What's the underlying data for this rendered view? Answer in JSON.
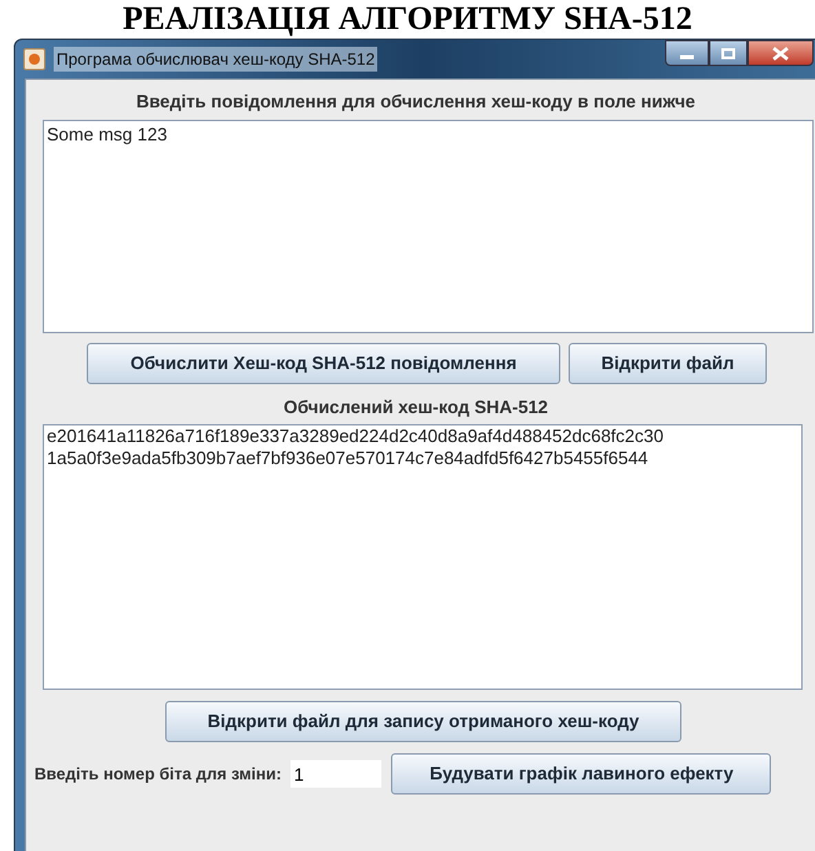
{
  "heading": "РЕАЛІЗАЦІЯ АЛГОРИТМУ SHA-512",
  "window": {
    "title": "Програма обчислювач хеш-коду SHA-512"
  },
  "message_label": "Введіть повідомлення для обчислення хеш-коду в поле нижче",
  "message_field": {
    "value": "Some msg 123"
  },
  "buttons": [
    {
      "label": "Обчислити Хеш-код SHA-512 повідомлення"
    },
    {
      "label": "Відкрити файл"
    }
  ],
  "hash_label": "Обчислений хеш-код SHA-512",
  "hash_field": {
    "lines": [
      "e201641a11826a716f189e337a3289ed224d2c40d8a9af4d488452dc68fc2c30",
      "1a5a0f3e9ada5fb309b7aef7bf936e07e570174c7e84adfd5f6427b5455f6544"
    ]
  },
  "save_button": "Відкрити файл для запису отриманого хеш-коду",
  "bit_label": "Введіть номер біта для зміни:",
  "bit_field": {
    "value": "1"
  },
  "chart_button": "Будувати графік лавиного ефекту"
}
